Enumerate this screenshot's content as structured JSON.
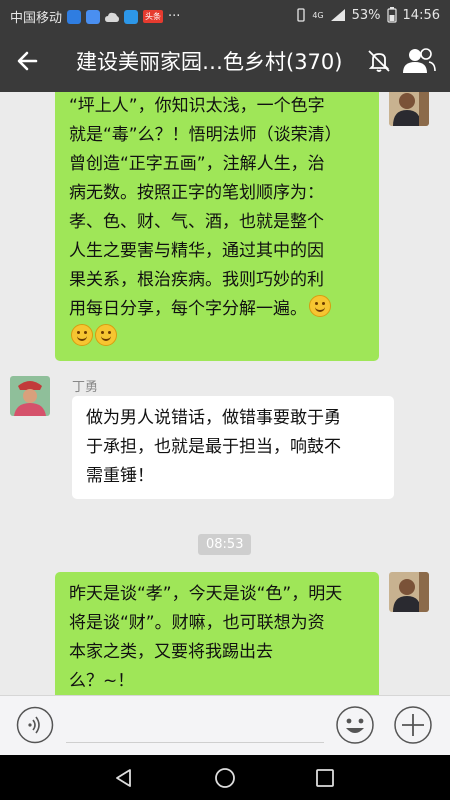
{
  "status_bar": {
    "carrier": "中国移动",
    "notif_badge": "头条",
    "more": "···",
    "network": "4G",
    "battery": "53%",
    "time": "14:56"
  },
  "header": {
    "title": "建设美丽家园…色乡村(370)"
  },
  "messages": [
    {
      "side": "right",
      "lines": [
        "“坪上人”，你知识太浅，一个色字",
        "就是“毒”么？！悟明法师（谈荣清）",
        "曾创造“正字五画”，注解人生，治",
        "病无数。按照正字的笔划顺序为：",
        "孝、色、财、气、酒，也就是整个",
        "人生之要害与精华，通过其中的因",
        "果关系，根治疾病。我则巧妙的利",
        "用每日分享，每个字分解一遍。"
      ]
    },
    {
      "side": "left",
      "sender": "丁勇",
      "lines": [
        "做为男人说错话，做错事要敢于勇",
        "于承担，也就是最于担当，响鼓不",
        "需重锤！"
      ]
    },
    {
      "type": "time",
      "text": "08:53"
    },
    {
      "side": "right",
      "lines": [
        "昨天是谈“孝”，今天是谈“色”，明天",
        "将是谈“财”。财嘛，也可联想为资",
        "本家之类，又要将我踢出去",
        "么？~！"
      ]
    }
  ],
  "colors": {
    "bar_bg": "#3a3a3a",
    "chat_bg": "#ebebeb",
    "self_bubble": "#9fe658",
    "other_bubble": "#ffffff",
    "input_bg": "#f4f4f6"
  },
  "icons": {
    "back": "back-arrow-icon",
    "mute": "mute-bell-icon",
    "members": "group-members-icon",
    "voice": "voice-input-icon",
    "emoji": "emoji-icon",
    "plus": "more-plus-icon"
  }
}
